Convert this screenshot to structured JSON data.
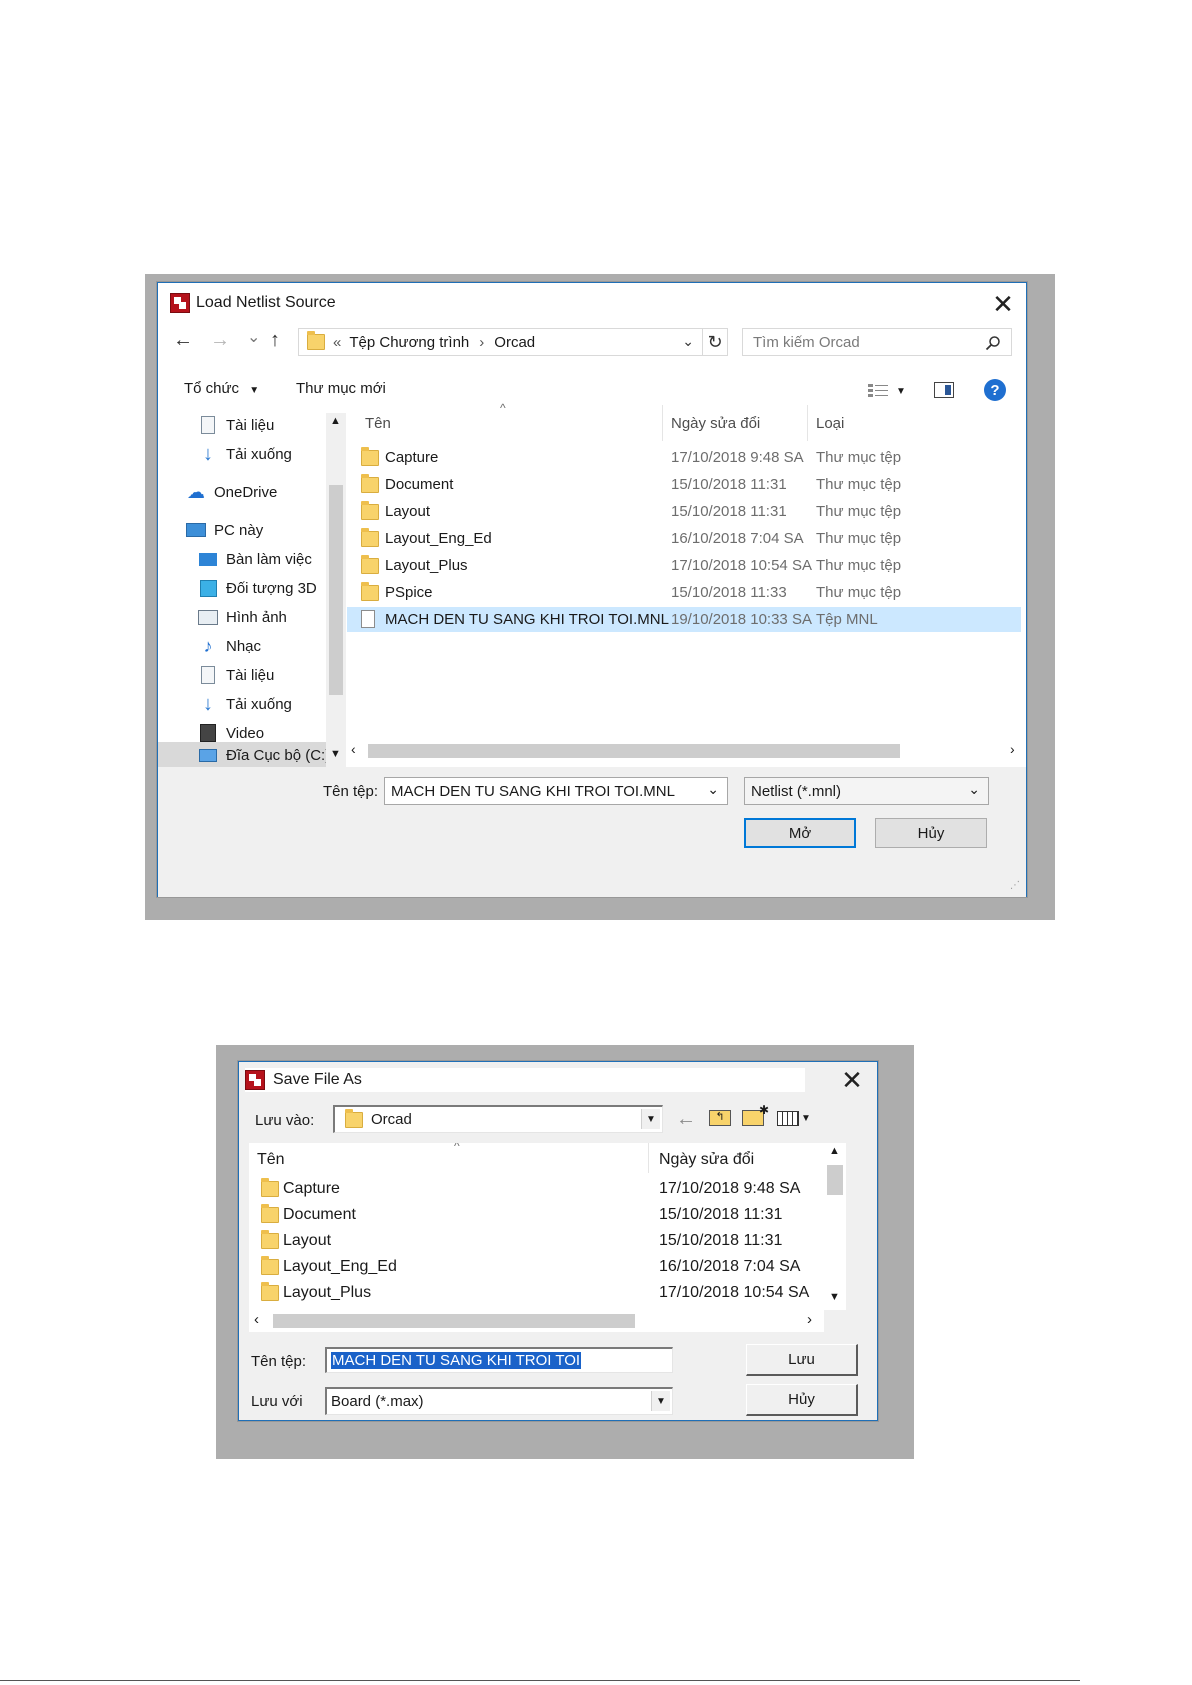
{
  "load_dialog": {
    "title": "Load Netlist Source",
    "close_glyph": "✕",
    "nav": {
      "back": "←",
      "forward": "→",
      "recent": "⌄",
      "up": "↑"
    },
    "breadcrumb": {
      "prefix": "«",
      "parts": [
        "Tệp Chương trình",
        "Orcad"
      ],
      "sep": "›"
    },
    "refresh_glyph": "↻",
    "search_placeholder": "Tìm kiếm Orcad",
    "toolbar": {
      "organize": "Tổ chức",
      "new_folder": "Thư mục mới"
    },
    "sidebar": [
      {
        "label": "Tài liệu",
        "icon": "document-icon"
      },
      {
        "label": "Tải xuống",
        "icon": "download-icon"
      },
      {
        "label": "OneDrive",
        "icon": "cloud-icon"
      },
      {
        "label": "PC này",
        "icon": "computer-icon"
      },
      {
        "label": "Bàn làm việc",
        "icon": "desktop-icon"
      },
      {
        "label": "Đối tượng 3D",
        "icon": "cube-icon"
      },
      {
        "label": "Hình ảnh",
        "icon": "picture-icon"
      },
      {
        "label": "Nhạc",
        "icon": "music-icon"
      },
      {
        "label": "Tài liệu",
        "icon": "document-icon"
      },
      {
        "label": "Tải xuống",
        "icon": "download-icon"
      },
      {
        "label": "Video",
        "icon": "video-icon"
      },
      {
        "label": "Đĩa Cục bộ (C:)",
        "icon": "drive-icon"
      }
    ],
    "columns": {
      "name": "Tên",
      "date": "Ngày sửa đổi",
      "type": "Loại"
    },
    "files": [
      {
        "name": "Capture",
        "date": "17/10/2018 9:48 SA",
        "type": "Thư mục tệp",
        "kind": "folder"
      },
      {
        "name": "Document",
        "date": "15/10/2018 11:31",
        "type": "Thư mục tệp",
        "kind": "folder"
      },
      {
        "name": "Layout",
        "date": "15/10/2018 11:31",
        "type": "Thư mục tệp",
        "kind": "folder"
      },
      {
        "name": "Layout_Eng_Ed",
        "date": "16/10/2018 7:04 SA",
        "type": "Thư mục tệp",
        "kind": "folder"
      },
      {
        "name": "Layout_Plus",
        "date": "17/10/2018 10:54 SA",
        "type": "Thư mục tệp",
        "kind": "folder"
      },
      {
        "name": "PSpice",
        "date": "15/10/2018 11:33",
        "type": "Thư mục tệp",
        "kind": "folder"
      },
      {
        "name": "MACH DEN TU SANG KHI TROI TOI.MNL",
        "date": "19/10/2018 10:33 SA",
        "type": "Tệp MNL",
        "kind": "file",
        "selected": true
      }
    ],
    "filename_label": "Tên tệp:",
    "filename_value": "MACH DEN TU SANG KHI TROI TOI.MNL",
    "filter_value": "Netlist (*.mnl)",
    "open_button": "Mở",
    "cancel_button": "Hủy"
  },
  "save_dialog": {
    "title": "Save File As",
    "close_glyph": "✕",
    "save_in_label": "Lưu vào:",
    "save_in_value": "Orcad",
    "columns": {
      "name": "Tên",
      "date": "Ngày sửa đổi"
    },
    "files": [
      {
        "name": "Capture",
        "date": "17/10/2018 9:48 SA"
      },
      {
        "name": "Document",
        "date": "15/10/2018 11:31"
      },
      {
        "name": "Layout",
        "date": "15/10/2018 11:31"
      },
      {
        "name": "Layout_Eng_Ed",
        "date": "16/10/2018 7:04 SA"
      },
      {
        "name": "Layout_Plus",
        "date": "17/10/2018 10:54 SA"
      }
    ],
    "filename_label": "Tên tệp:",
    "filename_value": "MACH DEN TU SANG KHI TROI TOI",
    "save_as_label": "Lưu với",
    "save_as_value": "Board (*.max)",
    "save_button": "Lưu",
    "cancel_button": "Hủy"
  }
}
